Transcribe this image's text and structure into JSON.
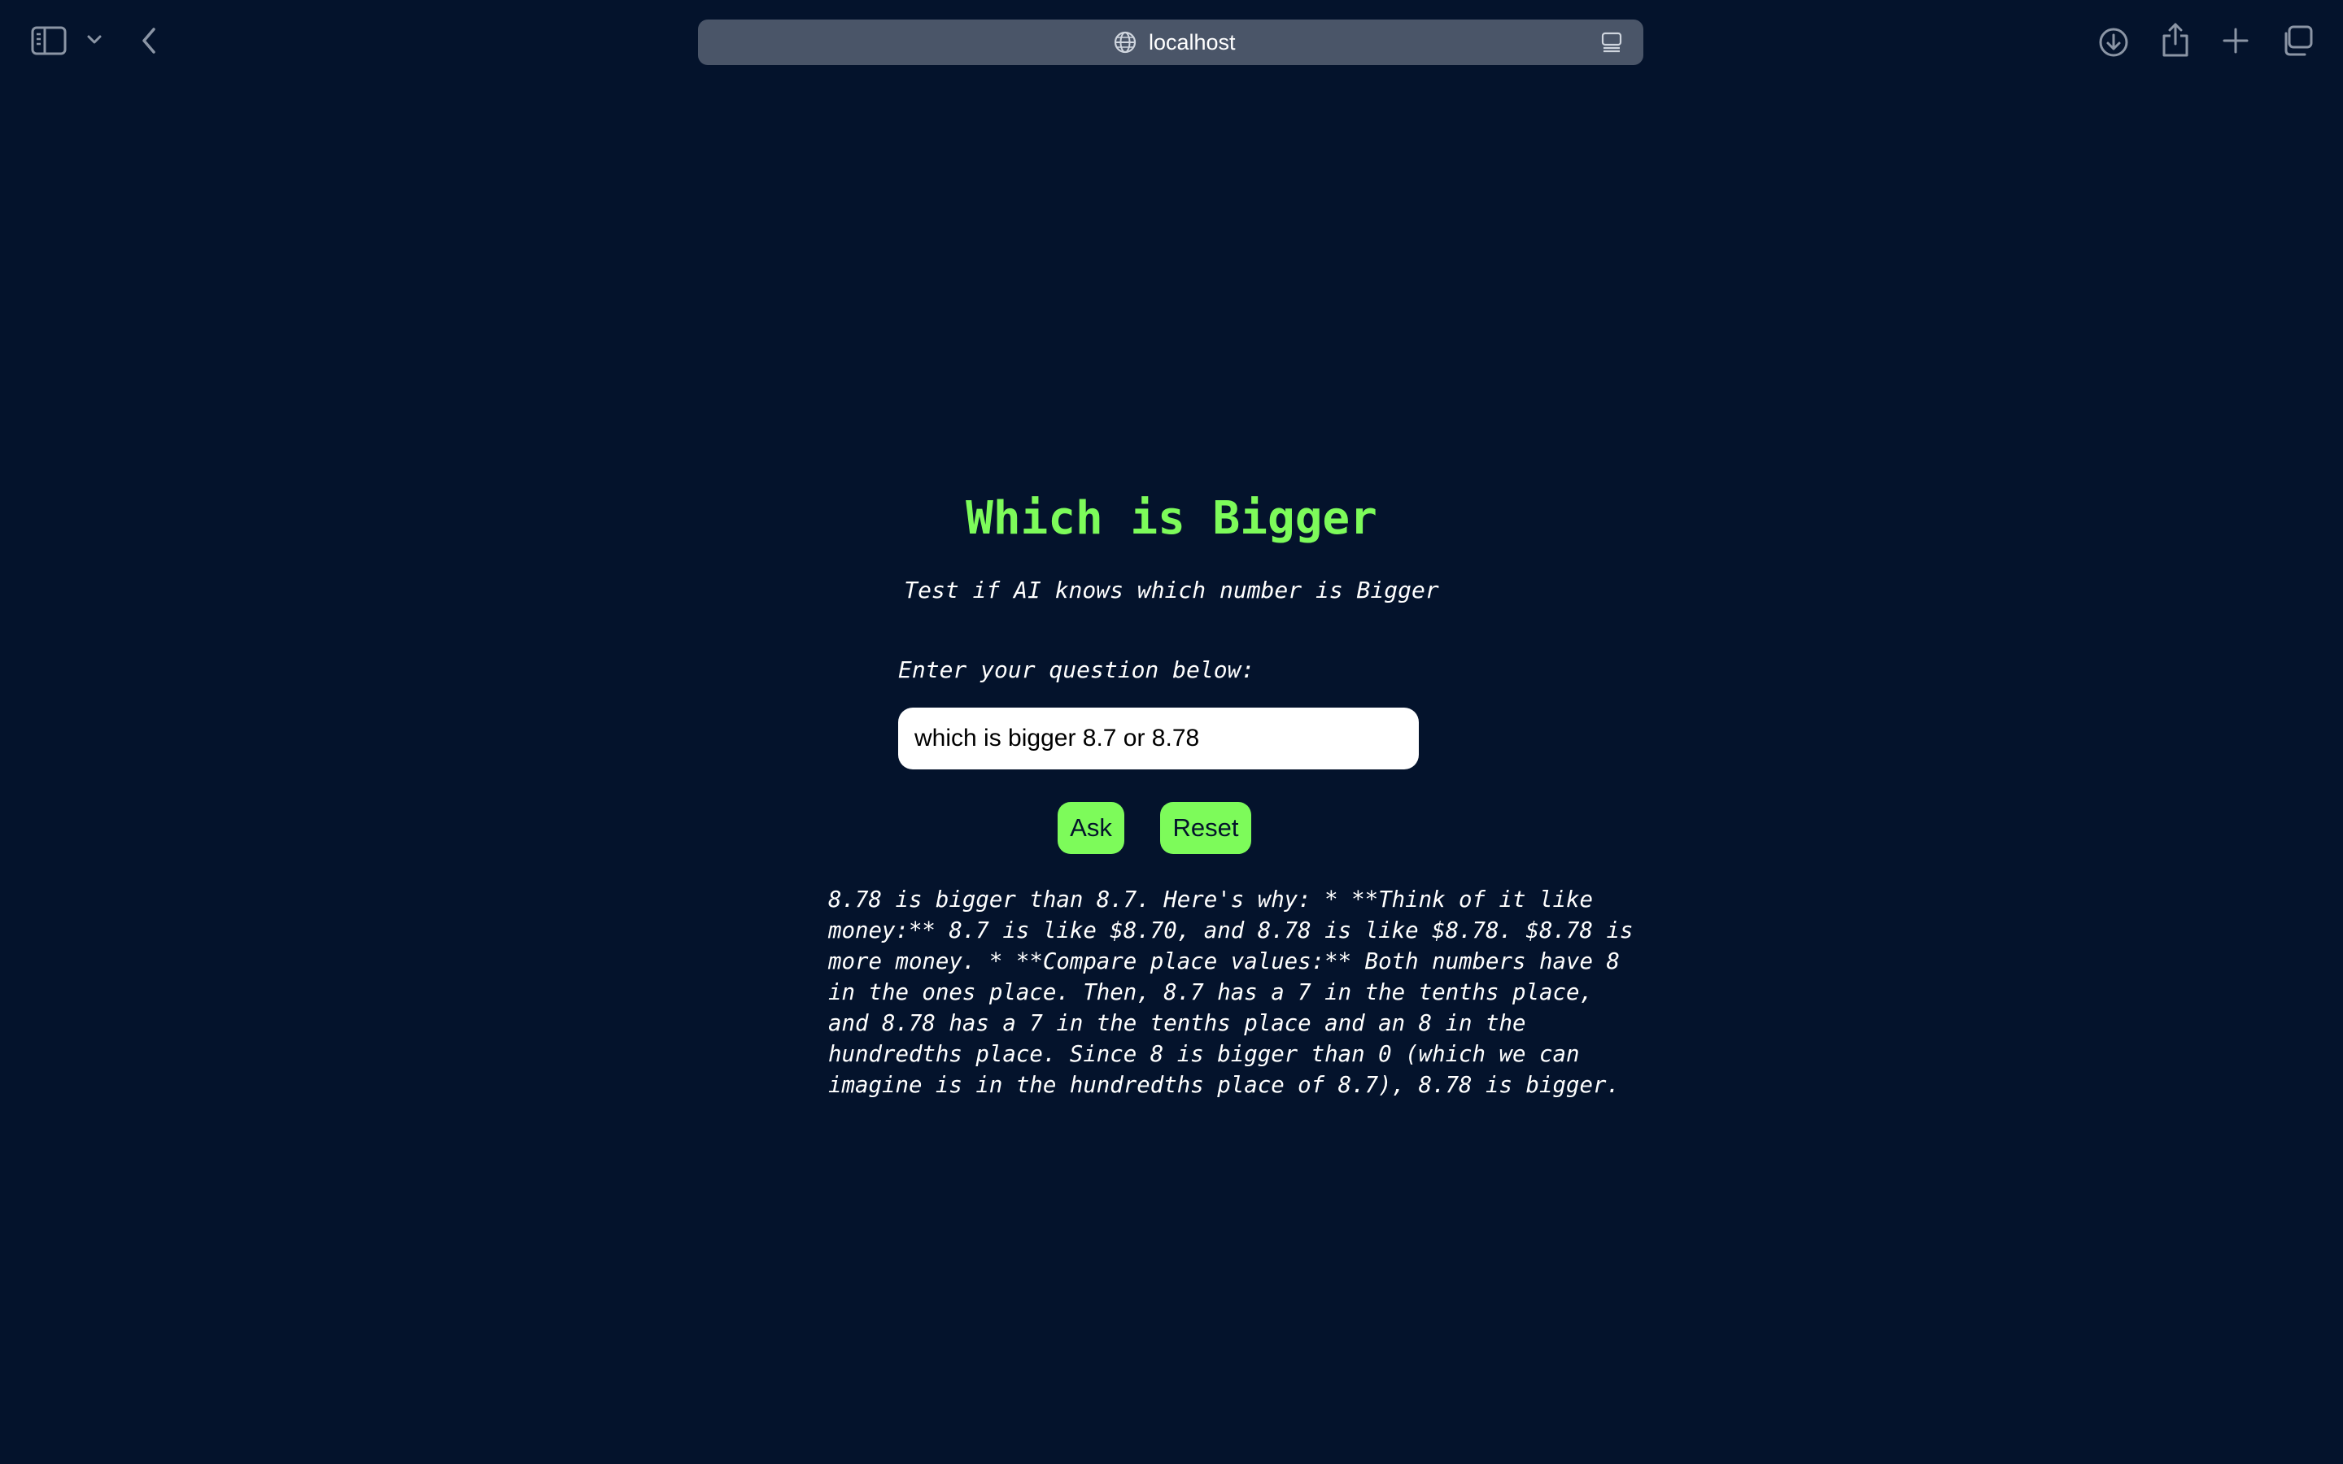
{
  "browser": {
    "url": "localhost",
    "icons": {
      "sidebar": "sidebar-icon",
      "tab_menu": "chevron-down-icon",
      "back": "chevron-left-icon",
      "site": "globe-icon",
      "reader": "reader-icon",
      "download": "download-icon",
      "share": "share-icon",
      "new_tab": "plus-icon",
      "tabs": "tabs-overview-icon"
    }
  },
  "page": {
    "title": "Which is Bigger",
    "subtitle": "Test if AI knows which number is Bigger",
    "prompt_label": "Enter your question below:",
    "question_value": "which is bigger 8.7 or 8.78",
    "ask_label": "Ask",
    "reset_label": "Reset",
    "answer": "8.78 is bigger than 8.7. Here's why: * **Think of it like money:** 8.7 is like $8.70, and 8.78 is like $8.78. $8.78 is more money. * **Compare place values:** Both numbers have 8 in the ones place. Then, 8.7 has a 7 in the tenths place, and 8.78 has a 7 in the tenths place and an 8 in the hundredths place. Since 8 is bigger than 0 (which we can imagine is in the hundredths place of 8.7), 8.78 is bigger."
  },
  "colors": {
    "background": "#04132c",
    "accent": "#7dfb5a",
    "address_bar": "#4a5568",
    "text": "#ffffff"
  }
}
